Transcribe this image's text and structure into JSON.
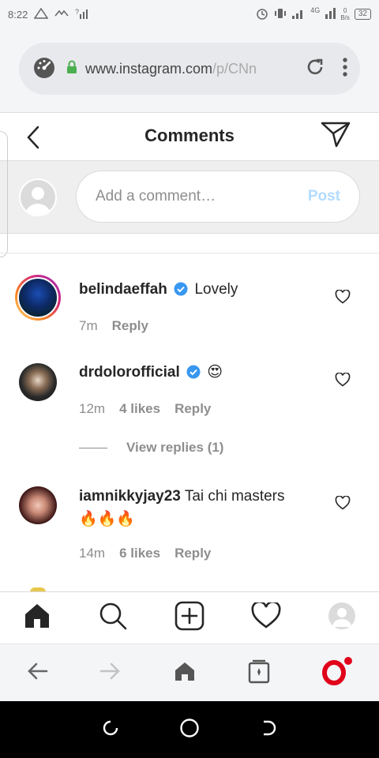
{
  "status_bar": {
    "time": "8:22",
    "network": "4G",
    "speed": "0",
    "speed_unit": "B/s",
    "battery": "32"
  },
  "browser": {
    "url_main": "www.instagram.com",
    "url_rest": "/p/CNn"
  },
  "header": {
    "title": "Comments"
  },
  "add_comment": {
    "placeholder": "Add a comment…",
    "post_label": "Post"
  },
  "comments": [
    {
      "username": "belindaeffah",
      "verified": true,
      "text": "Lovely",
      "time": "7m",
      "likes": "",
      "reply_label": "Reply"
    },
    {
      "username": "drdolorofficial",
      "verified": true,
      "text": "😍",
      "time": "12m",
      "likes": "4 likes",
      "reply_label": "Reply",
      "view_replies": "View replies (1)"
    },
    {
      "username": "iamnikkyjay23",
      "verified": false,
      "text": "Tai chi masters",
      "text_line2": "🔥🔥🔥",
      "time": "14m",
      "likes": "6 likes",
      "reply_label": "Reply"
    }
  ],
  "ig_nav": {
    "icons": [
      "home-icon",
      "search-icon",
      "add-post-icon",
      "activity-heart-icon",
      "profile-avatar"
    ]
  },
  "browser_nav": {
    "icons": [
      "back-arrow-icon",
      "forward-arrow-icon",
      "home-icon",
      "tabs-icon",
      "opera-logo"
    ]
  },
  "colors": {
    "accent_blue": "#3897f0",
    "post_disabled": "#b3dbff",
    "opera_red": "#e0001a"
  }
}
